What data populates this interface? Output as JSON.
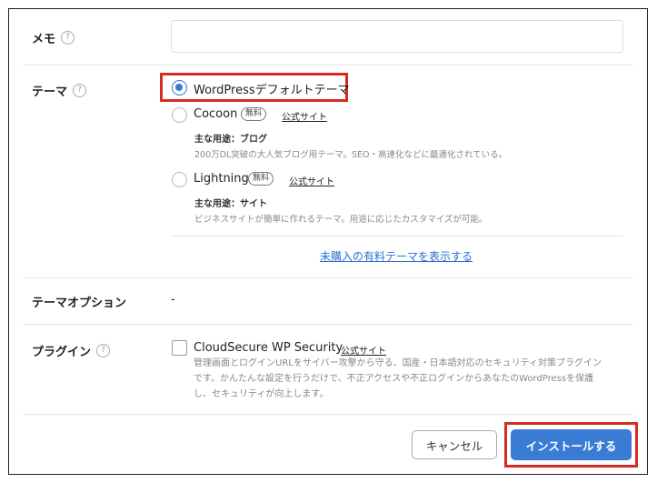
{
  "memo": {
    "label": "メモ",
    "help": "?",
    "value": ""
  },
  "theme": {
    "label": "テーマ",
    "help": "?",
    "options": [
      {
        "name": "WordPressデフォルトテーマ",
        "selected": true
      },
      {
        "name": "Cocoon",
        "badge": "無料",
        "link": "公式サイト",
        "use": "主な用途：ブログ",
        "desc": "200万DL突破の大人気ブログ用テーマ。SEO・高速化などに最適化されている。",
        "selected": false
      },
      {
        "name": "Lightning",
        "badge": "無料",
        "link": "公式サイト",
        "use": "主な用途：サイト",
        "desc": "ビジネスサイトが簡単に作れるテーマ。用途に応じたカスタマイズが可能。",
        "selected": false
      }
    ],
    "show_paid_link": "未購入の有料テーマを表示する"
  },
  "theme_option": {
    "label": "テーマオプション",
    "value": "-"
  },
  "plugin": {
    "label": "プラグイン",
    "help": "?",
    "name": "CloudSecure WP Security",
    "link": "公式サイト",
    "checked": false,
    "desc": [
      "管理画面とログインURLをサイバー攻撃から守る、国産・日本語対応のセキュリティ対策プラグイン",
      "です。かんたんな設定を行うだけで、不正アクセスや不正ログインからあなたのWordPressを保護",
      "し、セキュリティが向上します。"
    ]
  },
  "buttons": {
    "cancel": "キャンセル",
    "install": "インストールする"
  },
  "colors": {
    "accent": "#3a7bd5",
    "highlight": "#d62b23"
  }
}
